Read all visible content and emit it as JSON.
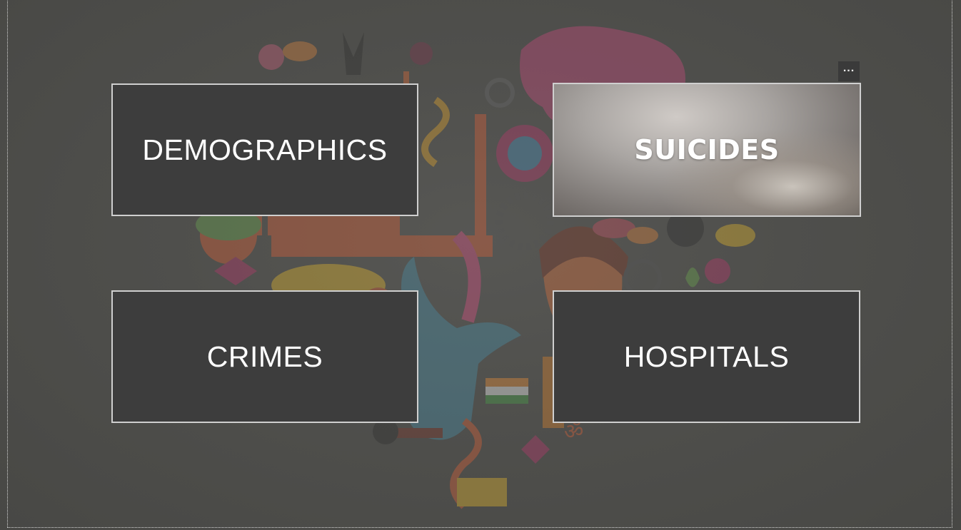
{
  "tiles": [
    {
      "label": "DEMOGRAPHICS"
    },
    {
      "label": "SUICIDES"
    },
    {
      "label": "CRIMES"
    },
    {
      "label": "HOSPITALS"
    }
  ],
  "visual_menu": {
    "icon": "more-options-icon",
    "glyph": "..."
  },
  "colors": {
    "background": "#4a4a47",
    "tile_fill": "#3d3d3d",
    "tile_border": "#cfcfcf",
    "text": "#ffffff"
  }
}
